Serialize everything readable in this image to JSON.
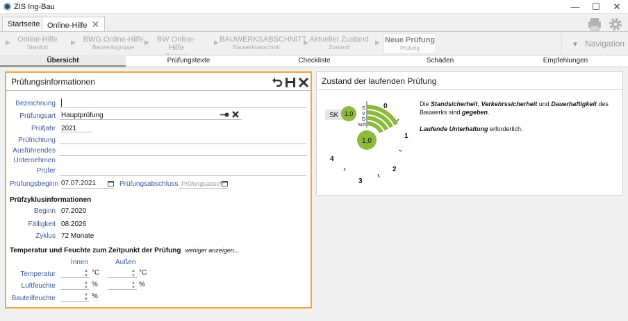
{
  "app": {
    "title": "ZIS Ing-Bau"
  },
  "window": {
    "minimize": "—",
    "maximize": "☐",
    "close": "✕"
  },
  "tabs": [
    {
      "label": "Startseite"
    },
    {
      "label": "Online-Hilfe",
      "close": "✕"
    }
  ],
  "breadcrumb": [
    {
      "title": "Online-Hilfe",
      "sub": "Standort"
    },
    {
      "title": "BWG Online-Hilfe",
      "sub": "Bauwerksgruppe"
    },
    {
      "title": "BW Online-Hilfe",
      "sub": "Bauwerk"
    },
    {
      "title": "BAUWERKSABSCHNITT",
      "sub": "Bauwerksabschnitt"
    },
    {
      "title": "Aktueller Zustand",
      "sub": "Zustand"
    },
    {
      "title": "Neue Prüfung",
      "sub": "Prüfung"
    }
  ],
  "navigation": {
    "label": "Navigation",
    "icon": "▼"
  },
  "subtabs": [
    "Übersicht",
    "Prüfungstexte",
    "Checkliste",
    "Schäden",
    "Empfehlungen"
  ],
  "left": {
    "title": "Prüfungsinformationen",
    "fields": {
      "bezeichnung": {
        "label": "Bezeichnung",
        "value": ""
      },
      "pruefungsart": {
        "label": "Prüfungsart",
        "value": "Hauptprüfung"
      },
      "pruefjahr": {
        "label": "Prüfjahr",
        "value": "2021"
      },
      "pruefrichtung": {
        "label": "Prüfrichtung",
        "value": ""
      },
      "unternehmen": {
        "label1": "Ausführendes",
        "label2": "Unternehmen",
        "value": ""
      },
      "pruefer": {
        "label": "Prüfer",
        "value": ""
      },
      "beginn": {
        "label": "Prüfungsbeginn",
        "value": "07.07.2021"
      },
      "abschluss": {
        "label": "Prüfungsabschluss",
        "placeholder": "Prüfungsabsch"
      }
    },
    "zyklus": {
      "title": "Prüfzyklusinformationen",
      "beginn": {
        "label": "Beginn",
        "value": "07.2020"
      },
      "faelligkeit": {
        "label": "Fälligkeit",
        "value": "08.2026"
      },
      "zyklus": {
        "label": "Zyklus",
        "value": "72 Monate"
      }
    },
    "temperatur": {
      "title": "Temperatur und Feuchte zum Zeitpunkt der Prüfung",
      "toggle": "weniger anzeigen...",
      "col_innen": "Innen",
      "col_aussen": "Außen",
      "rows": [
        {
          "label": "Temperatur",
          "unit": "°C",
          "unit2": "°C"
        },
        {
          "label": "Luftfeuchte",
          "unit": "%",
          "unit2": "%"
        },
        {
          "label": "Bauteilfeuchte",
          "unit": "%"
        }
      ]
    }
  },
  "right": {
    "title": "Zustand der laufenden Prüfung",
    "gauge": {
      "sk_label": "SK",
      "sk_value": "1,0",
      "main_value": "1,0",
      "letters": [
        "S",
        "V",
        "D",
        "Sch"
      ],
      "scale": [
        "0",
        "1",
        "2",
        "3",
        "4"
      ],
      "accent": "#8cba3c"
    },
    "text1": {
      "a": "Die ",
      "b": "Standsicherheit",
      "c": ", ",
      "d": "Verkehrssicherheit",
      "e": " und ",
      "f": "Dauerhaftigkeit",
      "g": " des Bauwerks sind ",
      "h": "gegeben",
      "i": "."
    },
    "text2": {
      "a": "Laufende Unterhaltung",
      "b": " erforderlich."
    }
  }
}
